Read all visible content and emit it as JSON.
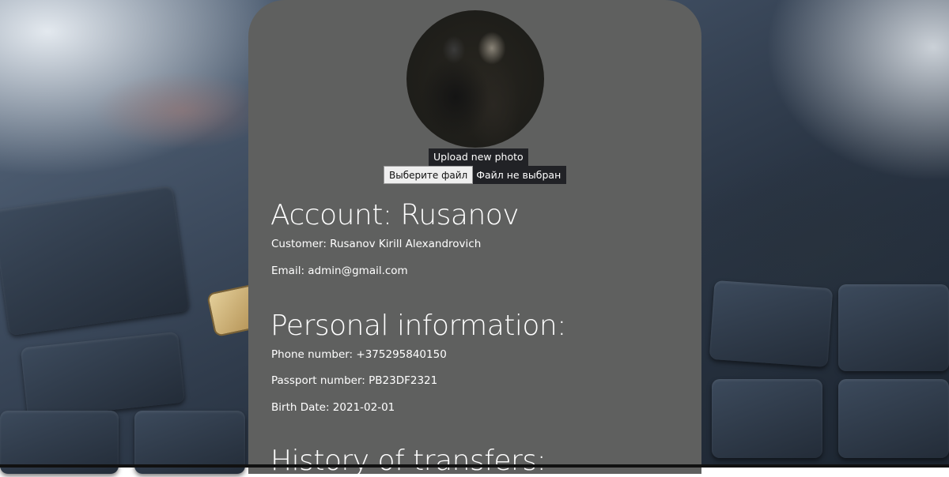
{
  "profile": {
    "upload_label": "Upload new photo",
    "file_choose_label": "Выберите файл",
    "file_status": "Файл не выбран"
  },
  "account": {
    "heading": "Account: Rusanov",
    "customer": "Customer: Rusanov Kirill Alexandrovich",
    "email": "Email: admin@gmail.com"
  },
  "personal": {
    "heading": "Personal information:",
    "phone": "Phone number: +375295840150",
    "passport": "Passport number: PB23DF2321",
    "birth_date": "Birth Date: 2021-02-01"
  },
  "transfers": {
    "heading": "History of transfers:"
  },
  "colors": {
    "panel": "#5f605f",
    "button_bg": "#212226",
    "text": "#ffffff"
  }
}
